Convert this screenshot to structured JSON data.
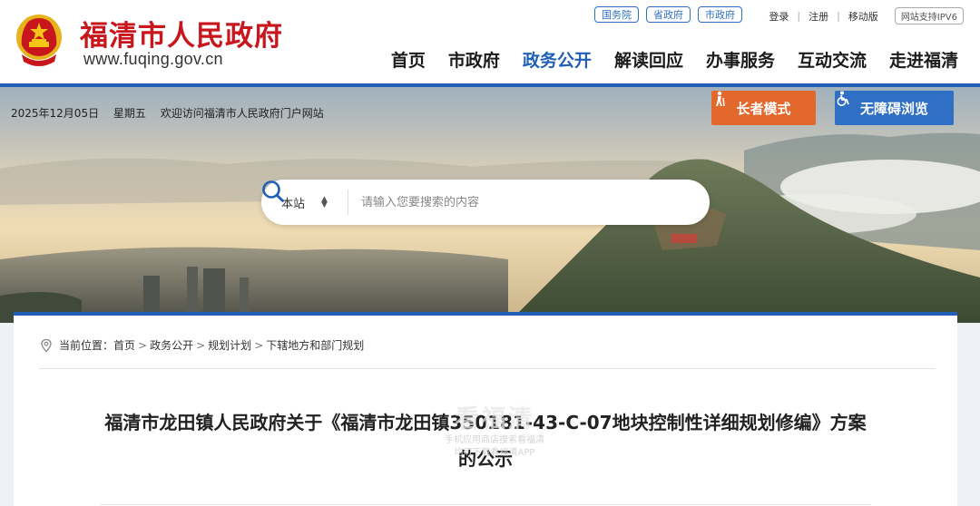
{
  "header": {
    "site_name": "福清市人民政府",
    "site_url": "www.fuqing.gov.cn",
    "top_links": [
      "国务院",
      "省政府",
      "市政府"
    ],
    "login": "登录",
    "register": "注册",
    "mobile": "移动版",
    "ipv6": "网站支持IPV6",
    "nav": [
      {
        "label": "首页",
        "active": false
      },
      {
        "label": "市政府",
        "active": false
      },
      {
        "label": "政务公开",
        "active": true
      },
      {
        "label": "解读回应",
        "active": false
      },
      {
        "label": "办事服务",
        "active": false
      },
      {
        "label": "互动交流",
        "active": false
      },
      {
        "label": "走进福清",
        "active": false
      }
    ]
  },
  "banner": {
    "date": "2025年12月05日",
    "weekday": "星期五",
    "welcome": "欢迎访问福清市人民政府门户网站",
    "elder_mode": "长者模式",
    "accessibility": "无障碍浏览",
    "search": {
      "scope": "本站",
      "placeholder": "请输入您要搜索的内容"
    }
  },
  "content": {
    "breadcrumb_label": "当前位置：",
    "breadcrumb": [
      "首页",
      "政务公开",
      "规划计划",
      "下辖地方和部门规划"
    ],
    "title": "福清市龙田镇人民政府关于《福清市龙田镇350181-43-C-07地块控制性详细规划修编》方案的公示"
  },
  "watermark": {
    "big": "看福清",
    "line1": "手机应用商店搜索看福清",
    "line2": "均可下载看福清APP"
  },
  "colors": {
    "brand_red": "#c8161d",
    "brand_blue": "#1f5fb8",
    "elder_orange": "#e3682b",
    "access_blue": "#2f6fc4"
  }
}
